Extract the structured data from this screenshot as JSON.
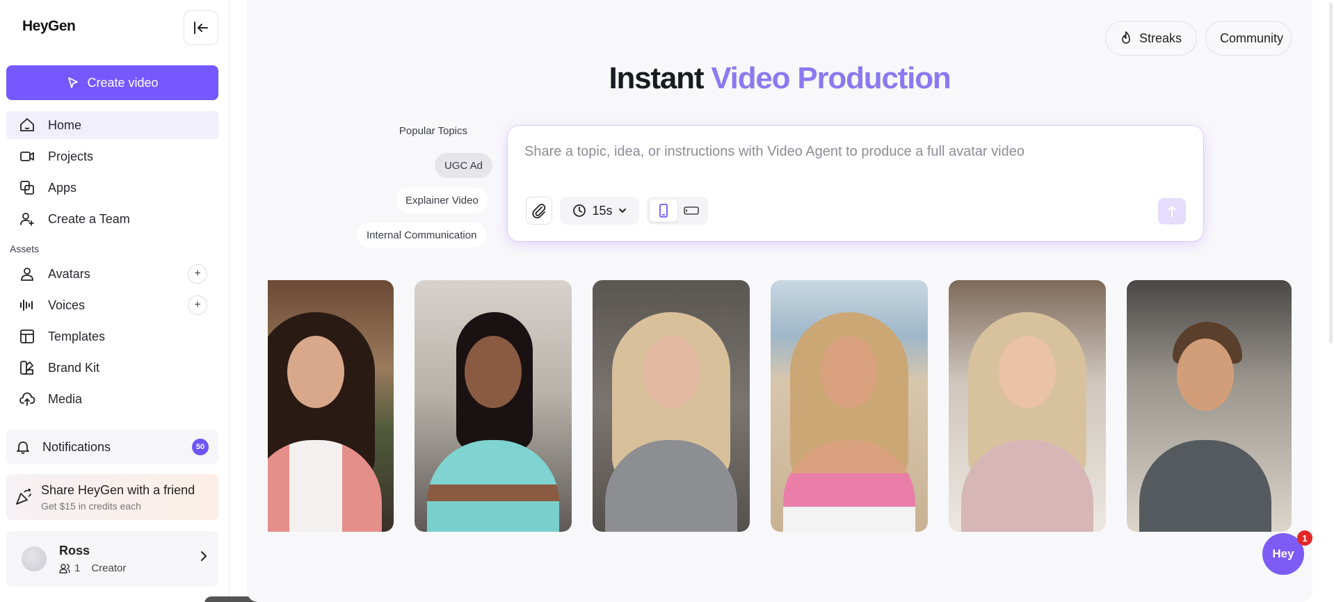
{
  "brand": {
    "logo_text": "HeyGen",
    "accent": "#7559ff"
  },
  "sidebar": {
    "create_label": "Create video",
    "items": [
      {
        "label": "Home",
        "icon": "home-icon",
        "active": true
      },
      {
        "label": "Projects",
        "icon": "video-camera-icon"
      },
      {
        "label": "Apps",
        "icon": "apps-icon"
      },
      {
        "label": "Create a Team",
        "icon": "add-user-icon"
      }
    ],
    "assets_label": "Assets",
    "assets": [
      {
        "label": "Avatars",
        "icon": "person-icon",
        "has_add": true
      },
      {
        "label": "Voices",
        "icon": "waveform-icon",
        "has_add": true
      },
      {
        "label": "Templates",
        "icon": "template-icon"
      },
      {
        "label": "Brand Kit",
        "icon": "palette-icon"
      },
      {
        "label": "Media",
        "icon": "cloud-upload-icon"
      }
    ],
    "notifications": {
      "label": "Notifications",
      "count": "50"
    },
    "share": {
      "title": "Share HeyGen with a friend",
      "subtitle": "Get $15 in credits each"
    },
    "user": {
      "name": "Ross",
      "seats": "1",
      "plan": "Creator"
    }
  },
  "header": {
    "streaks_label": "Streaks",
    "community_label": "Community"
  },
  "hero": {
    "title_plain": "Instant ",
    "title_accent": "Video Production"
  },
  "topics": {
    "label": "Popular Topics",
    "items": [
      "UGC Ad",
      "Explainer Video",
      "Internal Communication"
    ],
    "selected": "UGC Ad"
  },
  "prompt": {
    "placeholder": "Share a topic, idea, or instructions with Video Agent to produce a full avatar video",
    "duration": "15s"
  },
  "fab": {
    "label": "Hey",
    "badge": "1"
  }
}
